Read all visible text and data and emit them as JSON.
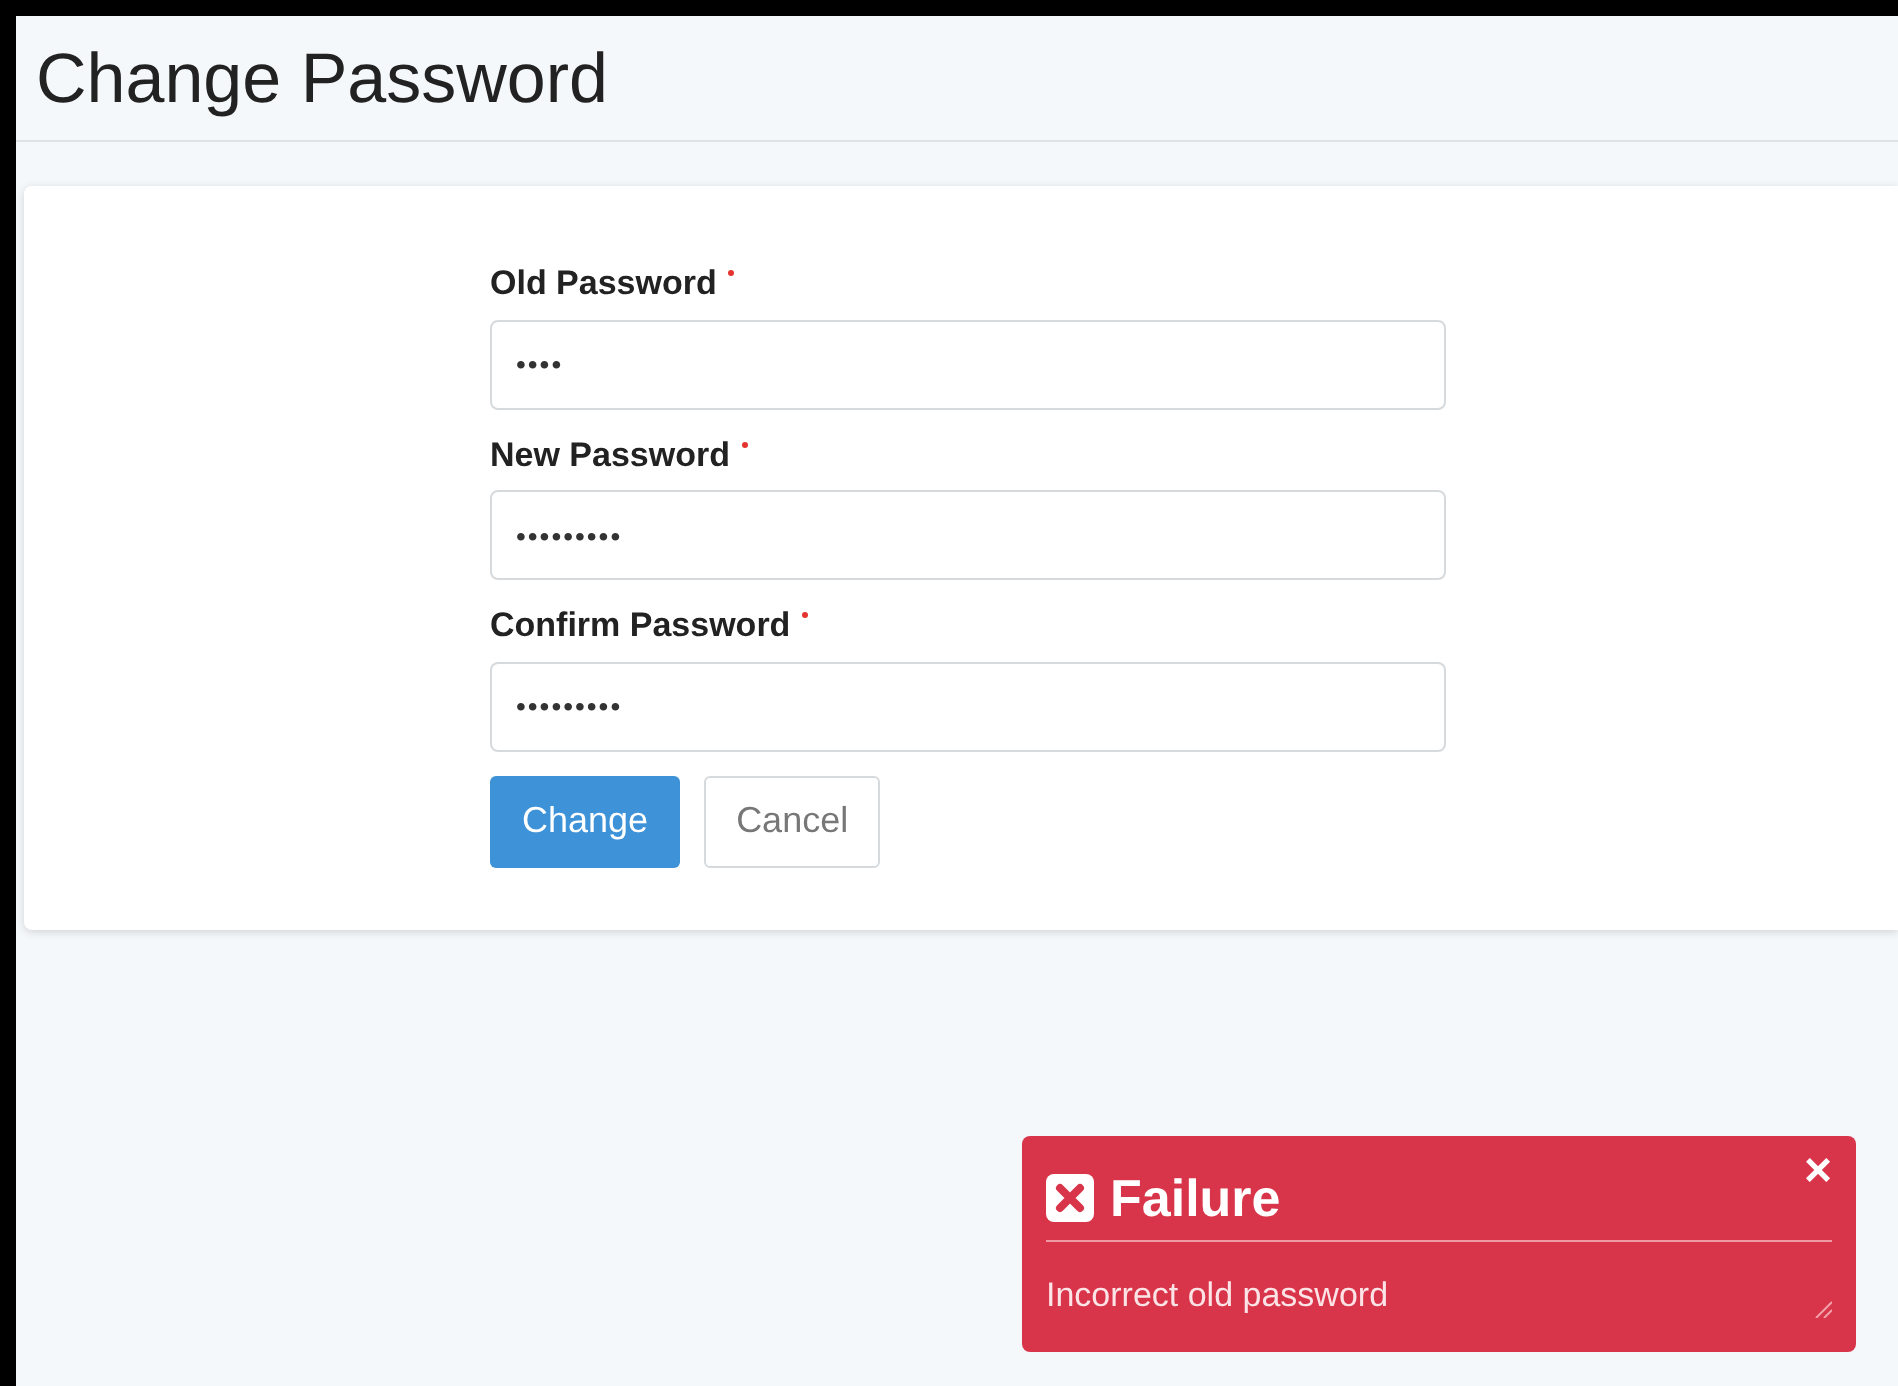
{
  "page": {
    "title": "Change Password"
  },
  "form": {
    "fields": [
      {
        "label": "Old Password",
        "required": true,
        "value": "••••"
      },
      {
        "label": "New Password",
        "required": true,
        "value": "•••••••••"
      },
      {
        "label": "Confirm Password",
        "required": true,
        "value": "•••••••••"
      }
    ],
    "buttons": [
      {
        "label": "Change",
        "kind": "primary"
      },
      {
        "label": "Cancel",
        "kind": "secondary"
      }
    ]
  },
  "toast": {
    "title": "Failure",
    "message": "Incorrect old password",
    "close": "×"
  }
}
